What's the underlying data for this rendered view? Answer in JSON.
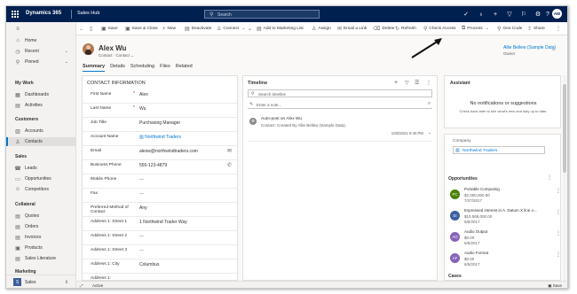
{
  "topbar": {
    "brand": "Dynamics 365",
    "app": "Sales Hub",
    "search_placeholder": "Search",
    "user_initials": "AW"
  },
  "sidebar": {
    "items_top": [
      {
        "label": "Home",
        "icon": "home-icon",
        "glyph": "⌂"
      },
      {
        "label": "Recent",
        "icon": "clock-icon",
        "glyph": "◷"
      },
      {
        "label": "Pinned",
        "icon": "pin-icon",
        "glyph": "⚲"
      }
    ],
    "groups": [
      {
        "title": "My Work",
        "items": [
          {
            "label": "Dashboards",
            "glyph": "▦"
          },
          {
            "label": "Activities",
            "glyph": "▤"
          }
        ]
      },
      {
        "title": "Customers",
        "items": [
          {
            "label": "Accounts",
            "glyph": "▥"
          },
          {
            "label": "Contacts",
            "glyph": "♙"
          }
        ]
      },
      {
        "title": "Sales",
        "items": [
          {
            "label": "Leads",
            "glyph": "☎"
          },
          {
            "label": "Opportunities",
            "glyph": "▭"
          },
          {
            "label": "Competitors",
            "glyph": "☺"
          }
        ]
      },
      {
        "title": "Collateral",
        "items": [
          {
            "label": "Quotes",
            "glyph": "▤"
          },
          {
            "label": "Orders",
            "glyph": "▤"
          },
          {
            "label": "Invoices",
            "glyph": "▤"
          },
          {
            "label": "Products",
            "glyph": "▣"
          },
          {
            "label": "Sales Literature",
            "glyph": "▤"
          }
        ]
      },
      {
        "title": "Marketing",
        "items": []
      }
    ],
    "area": {
      "badge": "S",
      "label": "Sales"
    }
  },
  "commands": [
    "Save",
    "Save & Close",
    "New",
    "Deactivate",
    "Connect",
    "Add to Marketing List",
    "Assign",
    "Email a Link",
    "Delete",
    "Refresh",
    "Check Access",
    "Process",
    "Geo Code",
    "Share"
  ],
  "header": {
    "name": "Alex Wu",
    "entity": "Contact",
    "form": "Contact",
    "owner": "Allie Bellew (Sample Data)",
    "owner_label": "Owner"
  },
  "tabs": [
    "Summary",
    "Details",
    "Scheduling",
    "Files",
    "Related"
  ],
  "contact_info": {
    "title": "CONTACT INFORMATION",
    "fields": [
      {
        "label": "First Name",
        "required": true,
        "value": "Alex",
        "kind": "text"
      },
      {
        "label": "Last Name",
        "required": true,
        "value": "Wu",
        "kind": "text"
      },
      {
        "label": "Job Title",
        "required": false,
        "value": "Purchasing Manager",
        "kind": "text"
      },
      {
        "label": "Account Name",
        "required": false,
        "value": "Northwind Traders",
        "kind": "link"
      },
      {
        "label": "Email",
        "required": false,
        "value": "alexw@northwindtraders.com",
        "kind": "text",
        "aux": "✉"
      },
      {
        "label": "Business Phone",
        "required": false,
        "value": "555-123-4879",
        "kind": "text",
        "aux": "✆"
      },
      {
        "label": "Mobile Phone",
        "required": false,
        "value": "---",
        "kind": "empty"
      },
      {
        "label": "Fax",
        "required": false,
        "value": "---",
        "kind": "empty"
      },
      {
        "label": "Preferred Method of Contact",
        "required": false,
        "value": "Any",
        "kind": "text"
      },
      {
        "label": "Address 1: Street 1",
        "required": false,
        "value": "1 Northwind Trader Way",
        "kind": "text"
      },
      {
        "label": "Address 1: Street 2",
        "required": false,
        "value": "---",
        "kind": "empty"
      },
      {
        "label": "Address 1: Street 3",
        "required": false,
        "value": "---",
        "kind": "empty"
      },
      {
        "label": "Address 1: City",
        "required": false,
        "value": "Columbus",
        "kind": "text"
      },
      {
        "label": "Address 1:",
        "required": false,
        "value": "",
        "kind": "empty"
      }
    ]
  },
  "timeline": {
    "title": "Timeline",
    "search_placeholder": "Search timeline",
    "note_placeholder": "Enter a note...",
    "post_title": "Auto-post on Alex Wu",
    "post_body": "Contact: Created By Allie Bellew (Sample Data).",
    "post_time": "1/30/2021 8:40 PM"
  },
  "assistant": {
    "title": "Assistant",
    "empty_title": "No notifications or suggestions",
    "empty_body": "Check back later to see what's new and stay up to date."
  },
  "company": {
    "label": "Company",
    "value": "Northwind Traders"
  },
  "opportunities": {
    "title": "Opportunities",
    "items": [
      {
        "initials": "PC",
        "color": "#498205",
        "name": "Portable Computing",
        "amount": "$2,000,000.00",
        "date": "7/27/2017"
      },
      {
        "initials": "EI",
        "color": "#3b5f9e",
        "name": "Expressed interest in A. Datum X line o...",
        "amount": "$10,568,000.00",
        "date": "6/5/2017"
      },
      {
        "initials": "AO",
        "color": "#8764b8",
        "name": "Audio Output",
        "amount": "$0.00",
        "date": "6/5/2017"
      },
      {
        "initials": "AF",
        "color": "#8764b8",
        "name": "Audio Format",
        "amount": "$0.00",
        "date": "6/5/2017"
      }
    ]
  },
  "cases_title": "Cases",
  "status": {
    "state": "Active",
    "save": "Save"
  }
}
